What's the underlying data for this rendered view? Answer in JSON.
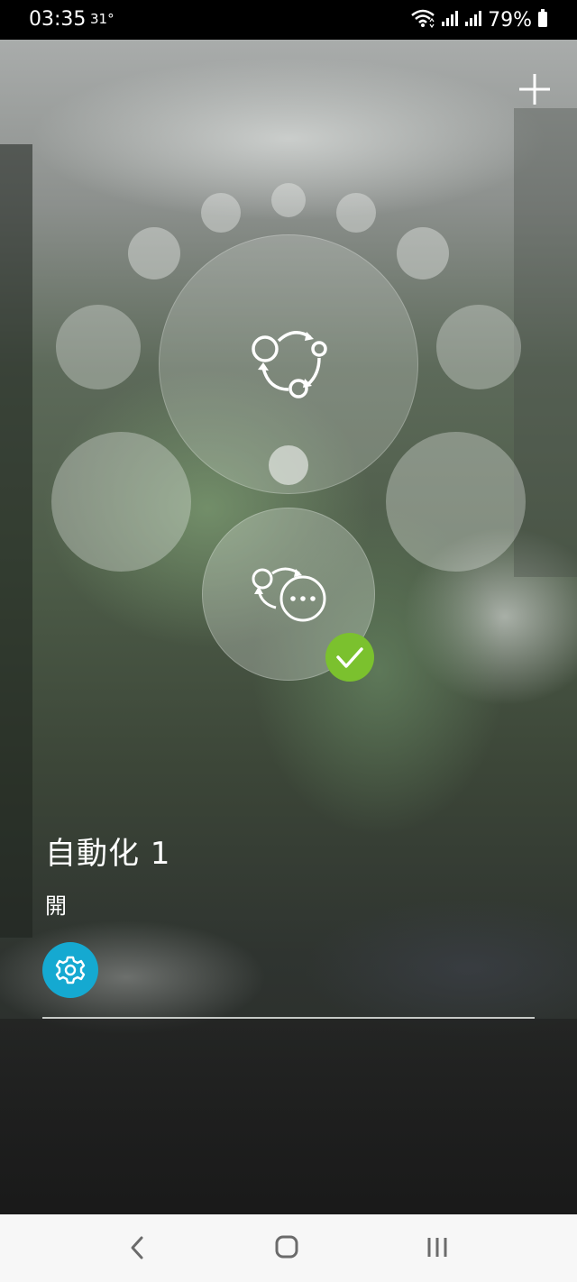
{
  "status_bar": {
    "time": "03:35",
    "temperature": "31°",
    "battery_percent": "79%",
    "icons": [
      "wifi-icon",
      "signal-icon",
      "signal-icon",
      "battery-icon"
    ]
  },
  "header": {
    "add_icon": "plus-icon"
  },
  "scene_picker": {
    "main_icon": "automation-cycle-icon",
    "selected_icon": "automation-more-icon",
    "selected_badge_icon": "checkmark-icon"
  },
  "automation": {
    "title": "自動化 1",
    "state": "開",
    "settings_icon": "gear-icon"
  },
  "nav": {
    "back_icon": "back-chevron-icon",
    "home_icon": "home-icon",
    "recents_icon": "recents-icon"
  },
  "colors": {
    "accent_blue": "#15a9d1",
    "check_green": "#7bc12e",
    "nav_background": "#f7f7f7"
  }
}
